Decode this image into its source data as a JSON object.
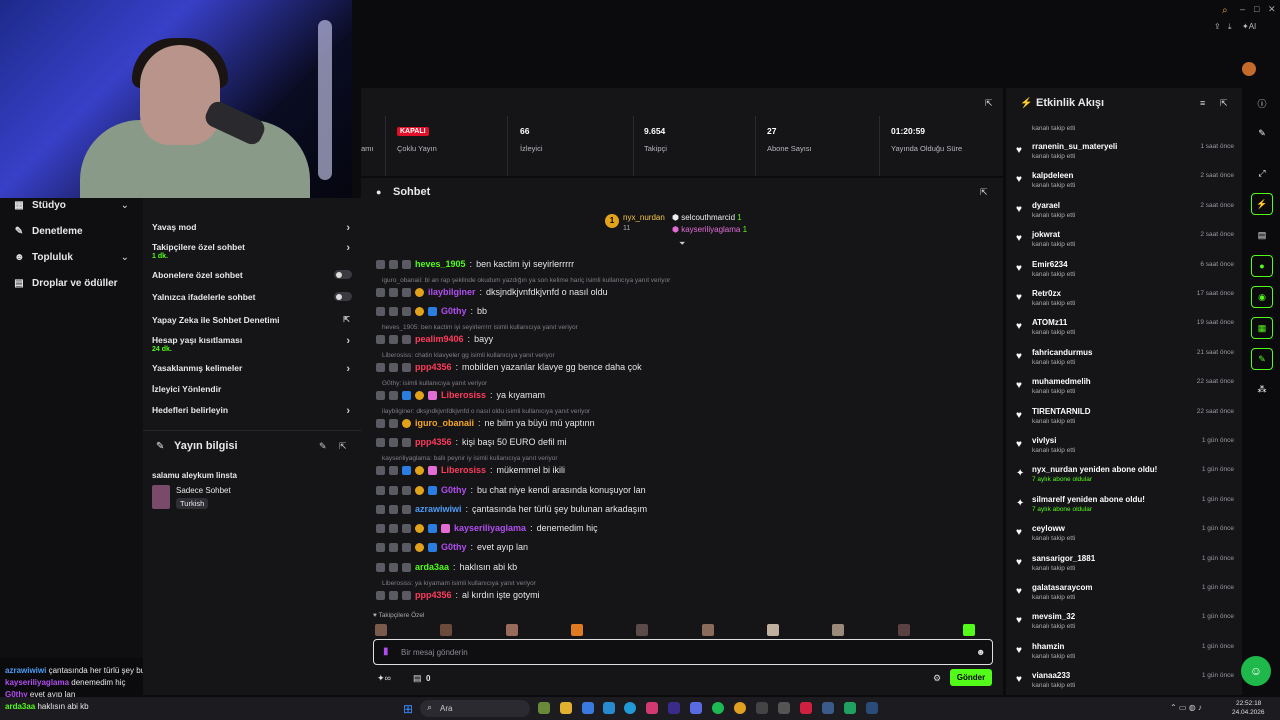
{
  "nav": {
    "items": [
      {
        "label": "Stüdyo",
        "icon": "grid-icon",
        "has_chevron": true
      },
      {
        "label": "Denetleme",
        "icon": "wrench-icon",
        "has_chevron": false
      },
      {
        "label": "Topluluk",
        "icon": "users-icon",
        "has_chevron": true
      },
      {
        "label": "Droplar ve ödüller",
        "icon": "gift-icon",
        "has_chevron": false
      }
    ]
  },
  "settings": {
    "slow_mode": "Yavaş mod",
    "followers_only": "Takipçilere özel sohbet",
    "followers_only_sub": "1 dk.",
    "subscribers_only": "Abonelere özel sohbet",
    "emotes_only": "Yalnızca ifadelerle sohbet",
    "ai_moderation": "Yapay Zeka ile Sohbet Denetimi",
    "account_age": "Hesap yaşı kısıtlaması",
    "account_age_sub": "24 dk.",
    "banned_words": "Yasaklanmış kelimeler",
    "redirect_viewers": "İzleyici Yönlendir",
    "set_goals": "Hedefleri belirleyin"
  },
  "stream_info": {
    "title": "Yayın bilgisi",
    "stream_title": "salamu aleykum linsta",
    "category": "Sadece Sohbet",
    "language_tag": "Turkish"
  },
  "stats": {
    "partial_label": "amı",
    "status_badge": "KAPALI",
    "multi_stream": "Çoklu Yayın",
    "viewers_value": "66",
    "viewers_label": "İzleyici",
    "followers_value": "9.654",
    "followers_label": "Takipçi",
    "subs_value": "27",
    "subs_label": "Abone Sayısı",
    "uptime_value": "01:20:59",
    "uptime_label": "Yayında Olduğu Süre"
  },
  "chat": {
    "title": "Sohbet",
    "top_gifter": {
      "name": "nyx_nurdan",
      "count": "11"
    },
    "pinned_users": [
      {
        "name": "selcouthmarcid",
        "count": "1"
      },
      {
        "name": "kayseriliyaglama",
        "count": "1"
      }
    ],
    "messages": [
      {
        "reply": "",
        "user": "heves_1905",
        "color": "#53fc18",
        "text": "ben kactim iyi seyirlerrrrr"
      },
      {
        "reply": "iguro_obanaii: bi an rap şeklinde okudum yazdığın ya son kelime hariç isimli kullanıcıya yanıt veriyor",
        "user": "ilaybilginer",
        "color": "#b14df0",
        "text": "dksjndkjvnfdkjvnfd o nasıl oldu"
      },
      {
        "reply": "",
        "user": "G0thy",
        "color": "#b14df0",
        "text": "bb"
      },
      {
        "reply": "heves_1905: ben kactim iyi seyirlerrrrr isimli kullanıcıya yanıt veriyor",
        "user": "pealim9406",
        "color": "#ff3b5c",
        "text": "bayy"
      },
      {
        "reply": "Liberosiss: chatin klavyeler gg isimli kullanıcıya yanıt veriyor",
        "user": "ppp4356",
        "color": "#ff3b5c",
        "text": "mobilden yazanlar klavye gg bence daha çok"
      },
      {
        "reply": "G0thy: isimli kullanıcıya yanıt veriyor",
        "user": "Liberosiss",
        "color": "#ff3b5c",
        "text": "ya kıyamam"
      },
      {
        "reply": "ilaybilginer: dksjndkjvnfdkjvnfd o nasıl oldu isimli kullanıcıya yanıt veriyor",
        "user": "iguro_obanaii",
        "color": "#f5a623",
        "text": "ne bilm ya büyü mü yaptınn"
      },
      {
        "reply": "",
        "user": "ppp4356",
        "color": "#ff3b5c",
        "text": "kişi başı 50 EURO defil mi"
      },
      {
        "reply": "kayseriliyaglama: ballı peynir iy isimli kullanıcıya yanıt veriyor",
        "user": "Liberosiss",
        "color": "#ff3b5c",
        "text": "mükemmel bi ikili"
      },
      {
        "reply": "",
        "user": "G0thy",
        "color": "#b14df0",
        "text": "bu chat niye kendi arasında konuşuyor lan"
      },
      {
        "reply": "",
        "user": "azrawiwiwi",
        "color": "#4d9cf5",
        "text": "çantasında her türlü şey bulunan arkadaşım"
      },
      {
        "reply": "",
        "user": "kayseriliyaglama",
        "color": "#b14df0",
        "text": "denemedim hiç"
      },
      {
        "reply": "",
        "user": "G0thy",
        "color": "#b14df0",
        "text": "evet ayıp lan"
      },
      {
        "reply": "",
        "user": "arda3aa",
        "color": "#53fc18",
        "text": "haklısın abi kb"
      },
      {
        "reply": "Liberosiss: ya kıyamam isimli kullanıcıya yanıt veriyor",
        "user": "ppp4356",
        "color": "#ff3b5c",
        "text": "al kırdın işte gotymi"
      }
    ],
    "followers_only_label": "Takipçilere Özel",
    "input_placeholder": "Bir mesaj gönderin",
    "points_value": "0",
    "send_label": "Gönder"
  },
  "activity": {
    "title": "Etkinlik Akışı",
    "partial_top": "kanalı takip etti",
    "items": [
      {
        "name": "rranenin_su_materyeli",
        "desc": "kanalı takip etti",
        "time": "1 saat önce",
        "type": "follow"
      },
      {
        "name": "kalpdeleen",
        "desc": "kanalı takip etti",
        "time": "2 saat önce",
        "type": "follow"
      },
      {
        "name": "dyarael",
        "desc": "kanalı takip etti",
        "time": "2 saat önce",
        "type": "follow"
      },
      {
        "name": "jokwrat",
        "desc": "kanalı takip etti",
        "time": "2 saat önce",
        "type": "follow"
      },
      {
        "name": "Emir6234",
        "desc": "kanalı takip etti",
        "time": "6 saat önce",
        "type": "follow"
      },
      {
        "name": "Retr0zx",
        "desc": "kanalı takip etti",
        "time": "17 saat önce",
        "type": "follow"
      },
      {
        "name": "ATOMz11",
        "desc": "kanalı takip etti",
        "time": "19 saat önce",
        "type": "follow"
      },
      {
        "name": "fahricandurmus",
        "desc": "kanalı takip etti",
        "time": "21 saat önce",
        "type": "follow"
      },
      {
        "name": "muhamedmelih",
        "desc": "kanalı takip etti",
        "time": "22 saat önce",
        "type": "follow"
      },
      {
        "name": "TIRENTARNILD",
        "desc": "kanalı takip etti",
        "time": "22 saat önce",
        "type": "follow"
      },
      {
        "name": "vivlysi",
        "desc": "kanalı takip etti",
        "time": "1 gün önce",
        "type": "follow"
      },
      {
        "name": "nyx_nurdan yeniden abone oldu!",
        "desc": "7 aylık abone oldular",
        "time": "1 gün önce",
        "type": "sub"
      },
      {
        "name": "silmarelf yeniden abone oldu!",
        "desc": "7 aylık abone oldular",
        "time": "1 gün önce",
        "type": "sub"
      },
      {
        "name": "ceyloww",
        "desc": "kanalı takip etti",
        "time": "1 gün önce",
        "type": "follow"
      },
      {
        "name": "sansarigor_1881",
        "desc": "kanalı takip etti",
        "time": "1 gün önce",
        "type": "follow"
      },
      {
        "name": "galatasaraycom",
        "desc": "kanalı takip etti",
        "time": "1 gün önce",
        "type": "follow"
      },
      {
        "name": "mevsim_32",
        "desc": "kanalı takip etti",
        "time": "1 gün önce",
        "type": "follow"
      },
      {
        "name": "hhamzin",
        "desc": "kanalı takip etti",
        "time": "1 gün önce",
        "type": "follow"
      },
      {
        "name": "vianaa233",
        "desc": "kanalı takip etti",
        "time": "1 gün önce",
        "type": "follow"
      }
    ]
  },
  "overlay_chat": [
    {
      "user": "azrawiwiwi",
      "color": "#4d9cf5",
      "text": "çantasında her türlü şey bulunan arkadaşım"
    },
    {
      "user": "kayseriliyaglama",
      "color": "#b14df0",
      "text": "denemedim hiç"
    },
    {
      "user": "G0thy",
      "color": "#b14df0",
      "text": "evet ayıp lan"
    },
    {
      "user": "arda3aa",
      "color": "#53fc18",
      "text": "haklısın abi kb"
    }
  ],
  "taskbar": {
    "search_label": "Ara",
    "time": "22:52:18",
    "date": "24.04.2026",
    "top_right_label": "AI"
  },
  "colors": {
    "accent": "#53fc18",
    "panel": "#151518",
    "background": "#0b0b0d",
    "danger": "#e0102a"
  }
}
